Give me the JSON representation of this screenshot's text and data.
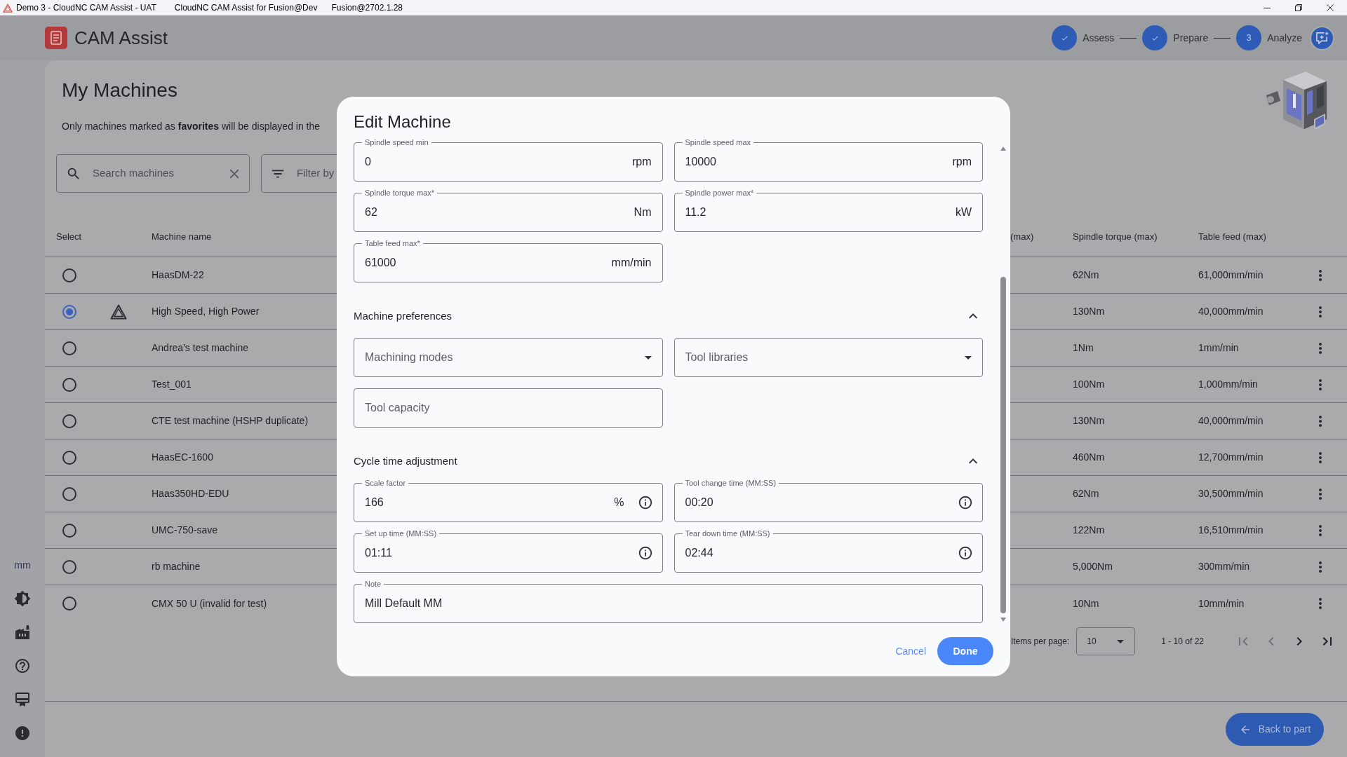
{
  "title_bar": {
    "title": "Demo 3 - CloudNC CAM Assist - UAT",
    "subtitle": "CloudNC CAM Assist for Fusion@Dev",
    "version": "Fusion@2702.1.28"
  },
  "header": {
    "app_name": "CAM Assist",
    "steps": [
      {
        "label": "Assess",
        "done": true
      },
      {
        "label": "Prepare",
        "done": true
      },
      {
        "label": "Analyze",
        "done": false,
        "number": "3"
      }
    ]
  },
  "sidebar": {
    "unit": "mm"
  },
  "page": {
    "title": "My Machines",
    "notice": "Only machines marked as **favorites** will be displayed in the",
    "search": {
      "placeholder": "Search machines"
    },
    "filter": {
      "placeholder": "Filter by"
    }
  },
  "table": {
    "columns": [
      {
        "label": "Select"
      },
      {
        "label": "Machine name"
      },
      {
        "label": "(max)"
      },
      {
        "label": "Spindle torque (max)"
      },
      {
        "label": "Table feed (max)"
      }
    ],
    "rows": [
      {
        "selected": false,
        "badge": false,
        "machine_name": "HaasDM-22",
        "spindle_torque": "62Nm",
        "table_feed": "61,000mm/min"
      },
      {
        "selected": true,
        "badge": true,
        "machine_name": "High Speed, High Power",
        "spindle_torque": "130Nm",
        "table_feed": "40,000mm/min"
      },
      {
        "selected": false,
        "badge": false,
        "machine_name": "Andrea's test machine",
        "spindle_torque": "1Nm",
        "table_feed": "1mm/min"
      },
      {
        "selected": false,
        "badge": false,
        "machine_name": "Test_001",
        "spindle_torque": "100Nm",
        "table_feed": "1,000mm/min"
      },
      {
        "selected": false,
        "badge": false,
        "machine_name": "CTE test machine (HSHP duplicate)",
        "spindle_torque": "130Nm",
        "table_feed": "40,000mm/min"
      },
      {
        "selected": false,
        "badge": false,
        "machine_name": "HaasEC-1600",
        "spindle_torque": "460Nm",
        "table_feed": "12,700mm/min"
      },
      {
        "selected": false,
        "badge": false,
        "machine_name": "Haas350HD-EDU",
        "spindle_torque": "62Nm",
        "table_feed": "30,500mm/min"
      },
      {
        "selected": false,
        "badge": false,
        "machine_name": "UMC-750-save",
        "spindle_torque": "122Nm",
        "table_feed": "16,510mm/min"
      },
      {
        "selected": false,
        "badge": false,
        "machine_name": "rb machine",
        "spindle_torque": "5,000Nm",
        "table_feed": "300mm/min"
      },
      {
        "selected": false,
        "badge": false,
        "machine_name": "CMX 50 U (invalid for test)",
        "spindle_torque": "10Nm",
        "table_feed": "10mm/min"
      }
    ]
  },
  "pagination": {
    "label": "Items per page:",
    "page_size": "10",
    "range": "1 - 10 of 22",
    "buttons": [
      {
        "kind": "first",
        "disabled": true
      },
      {
        "kind": "previous",
        "disabled": true
      },
      {
        "kind": "next",
        "disabled": false
      },
      {
        "kind": "last",
        "disabled": false
      }
    ]
  },
  "back_button": {
    "label": "Back to part"
  },
  "dialog": {
    "title": "Edit Machine",
    "fields": [
      {
        "kind": "input",
        "label": "Spindle speed min",
        "value": "0",
        "unit": "rpm"
      },
      {
        "kind": "input",
        "label": "Spindle speed max",
        "value": "10000",
        "unit": "rpm"
      },
      {
        "kind": "input",
        "label": "Spindle torque max*",
        "value": "62",
        "unit": "Nm"
      },
      {
        "kind": "input",
        "label": "Spindle power max*",
        "value": "11.2",
        "unit": "kW"
      },
      {
        "kind": "input",
        "label": "Table feed max*",
        "value": "61000",
        "unit": "mm/min"
      }
    ],
    "sections": [
      {
        "title": "Machine preferences",
        "expanded": true,
        "fields": [
          {
            "kind": "select",
            "placeholder": "Machining modes"
          },
          {
            "kind": "select",
            "placeholder": "Tool libraries"
          },
          {
            "kind": "input",
            "placeholder": "Tool capacity"
          }
        ]
      },
      {
        "title": "Cycle time adjustment",
        "expanded": true,
        "fields": [
          {
            "kind": "input",
            "label": "Scale factor",
            "value": "166",
            "unit": "%",
            "info": true
          },
          {
            "kind": "input",
            "label": "Tool change time (MM:SS)",
            "value": "00:20",
            "info": true
          },
          {
            "kind": "input",
            "label": "Set up time (MM:SS)",
            "value": "01:11",
            "info": true
          },
          {
            "kind": "input",
            "label": "Tear down time (MM:SS)",
            "value": "02:44",
            "info": true
          },
          {
            "kind": "note",
            "label": "Note",
            "value": "Mill Default MM"
          }
        ]
      }
    ],
    "actions": [
      {
        "kind": "text",
        "label": "Cancel"
      },
      {
        "kind": "primary",
        "label": "Done"
      }
    ]
  }
}
